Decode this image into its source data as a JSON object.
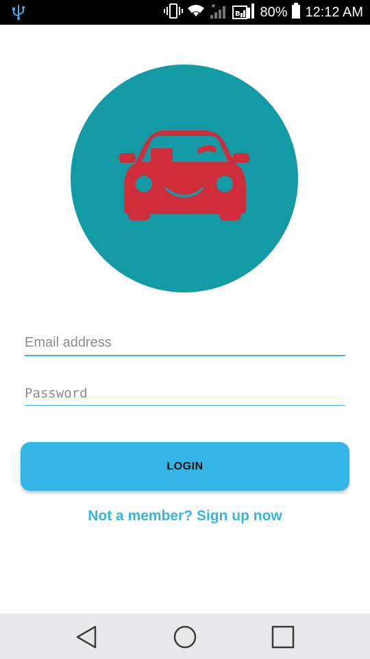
{
  "status_bar": {
    "battery": "80%",
    "time": "12:12 AM",
    "icons": [
      "usb-icon",
      "vibrate-icon",
      "wifi-icon",
      "signal-icon",
      "signal-icon",
      "battery-icon"
    ]
  },
  "logo": {
    "icon": "smiling-car-icon",
    "circle_color": "#129aa5",
    "car_color": "#d02d3a"
  },
  "form": {
    "email_placeholder": "Email address",
    "password_placeholder": "Password"
  },
  "login_label": "LOGIN",
  "signup_text": "Not a member? Sign up now",
  "colors": {
    "accent": "#33b5e5"
  },
  "nav_bar": {
    "icons": [
      "back-icon",
      "home-icon",
      "recents-icon"
    ]
  }
}
